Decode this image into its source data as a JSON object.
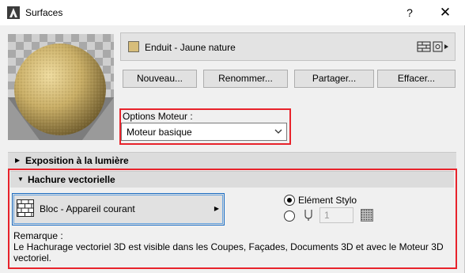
{
  "window": {
    "title": "Surfaces",
    "help_label": "?",
    "close_label": "✕"
  },
  "material": {
    "name": "Enduit - Jaune nature",
    "swatch_color": "#d7bd7a"
  },
  "buttons": {
    "new": "Nouveau...",
    "rename": "Renommer...",
    "share": "Partager...",
    "delete": "Effacer..."
  },
  "engine": {
    "label": "Options Moteur :",
    "selected": "Moteur basique"
  },
  "sections": {
    "exposure": "Exposition à la lumière",
    "vector_hatch": "Hachure vectorielle"
  },
  "hatch": {
    "fill_name": "Bloc - Appareil courant",
    "radio_pen_label": "Elément Stylo",
    "pen_value": "1",
    "remark_title": "Remarque :",
    "remark_text": "Le Hachurage vectoriel 3D est visible dans les Coupes, Façades, Documents 3D et avec le Moteur 3D vectoriel."
  },
  "colors": {
    "highlight_red": "#e8232b",
    "focus_blue": "#1a6cc3"
  }
}
